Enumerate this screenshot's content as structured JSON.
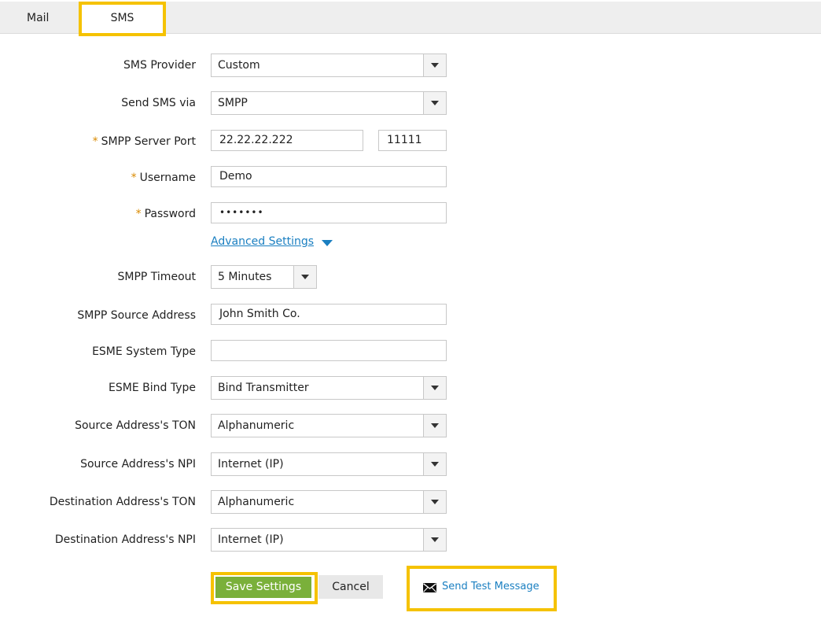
{
  "tabs": {
    "mail": "Mail",
    "sms": "SMS"
  },
  "form": {
    "sms_provider": {
      "label": "SMS Provider",
      "value": "Custom"
    },
    "send_via": {
      "label": "Send SMS via",
      "value": "SMPP"
    },
    "server_port": {
      "label": "SMPP Server Port",
      "server": "22.22.22.222",
      "port": "11111"
    },
    "username": {
      "label": "Username",
      "value": "Demo"
    },
    "password": {
      "label": "Password",
      "value": "•••••••"
    },
    "required_mark": "*",
    "advanced_link": "Advanced Settings",
    "timeout": {
      "label": "SMPP Timeout",
      "value": "5 Minutes"
    },
    "source_address": {
      "label": "SMPP Source Address",
      "value": "John Smith Co."
    },
    "esme_system_type": {
      "label": "ESME System Type",
      "value": ""
    },
    "esme_bind_type": {
      "label": "ESME Bind Type",
      "value": "Bind Transmitter"
    },
    "source_ton": {
      "label": "Source Address's TON",
      "value": "Alphanumeric"
    },
    "source_npi": {
      "label": "Source Address's NPI",
      "value": "Internet (IP)"
    },
    "dest_ton": {
      "label": "Destination Address's TON",
      "value": "Alphanumeric"
    },
    "dest_npi": {
      "label": "Destination Address's NPI",
      "value": "Internet (IP)"
    }
  },
  "actions": {
    "save": "Save Settings",
    "cancel": "Cancel",
    "send_test": "Send Test Message"
  },
  "colors": {
    "highlight": "#f5c200",
    "save_green": "#7ab03a",
    "link_blue": "#1a7fc1",
    "required": "#d98a00"
  }
}
